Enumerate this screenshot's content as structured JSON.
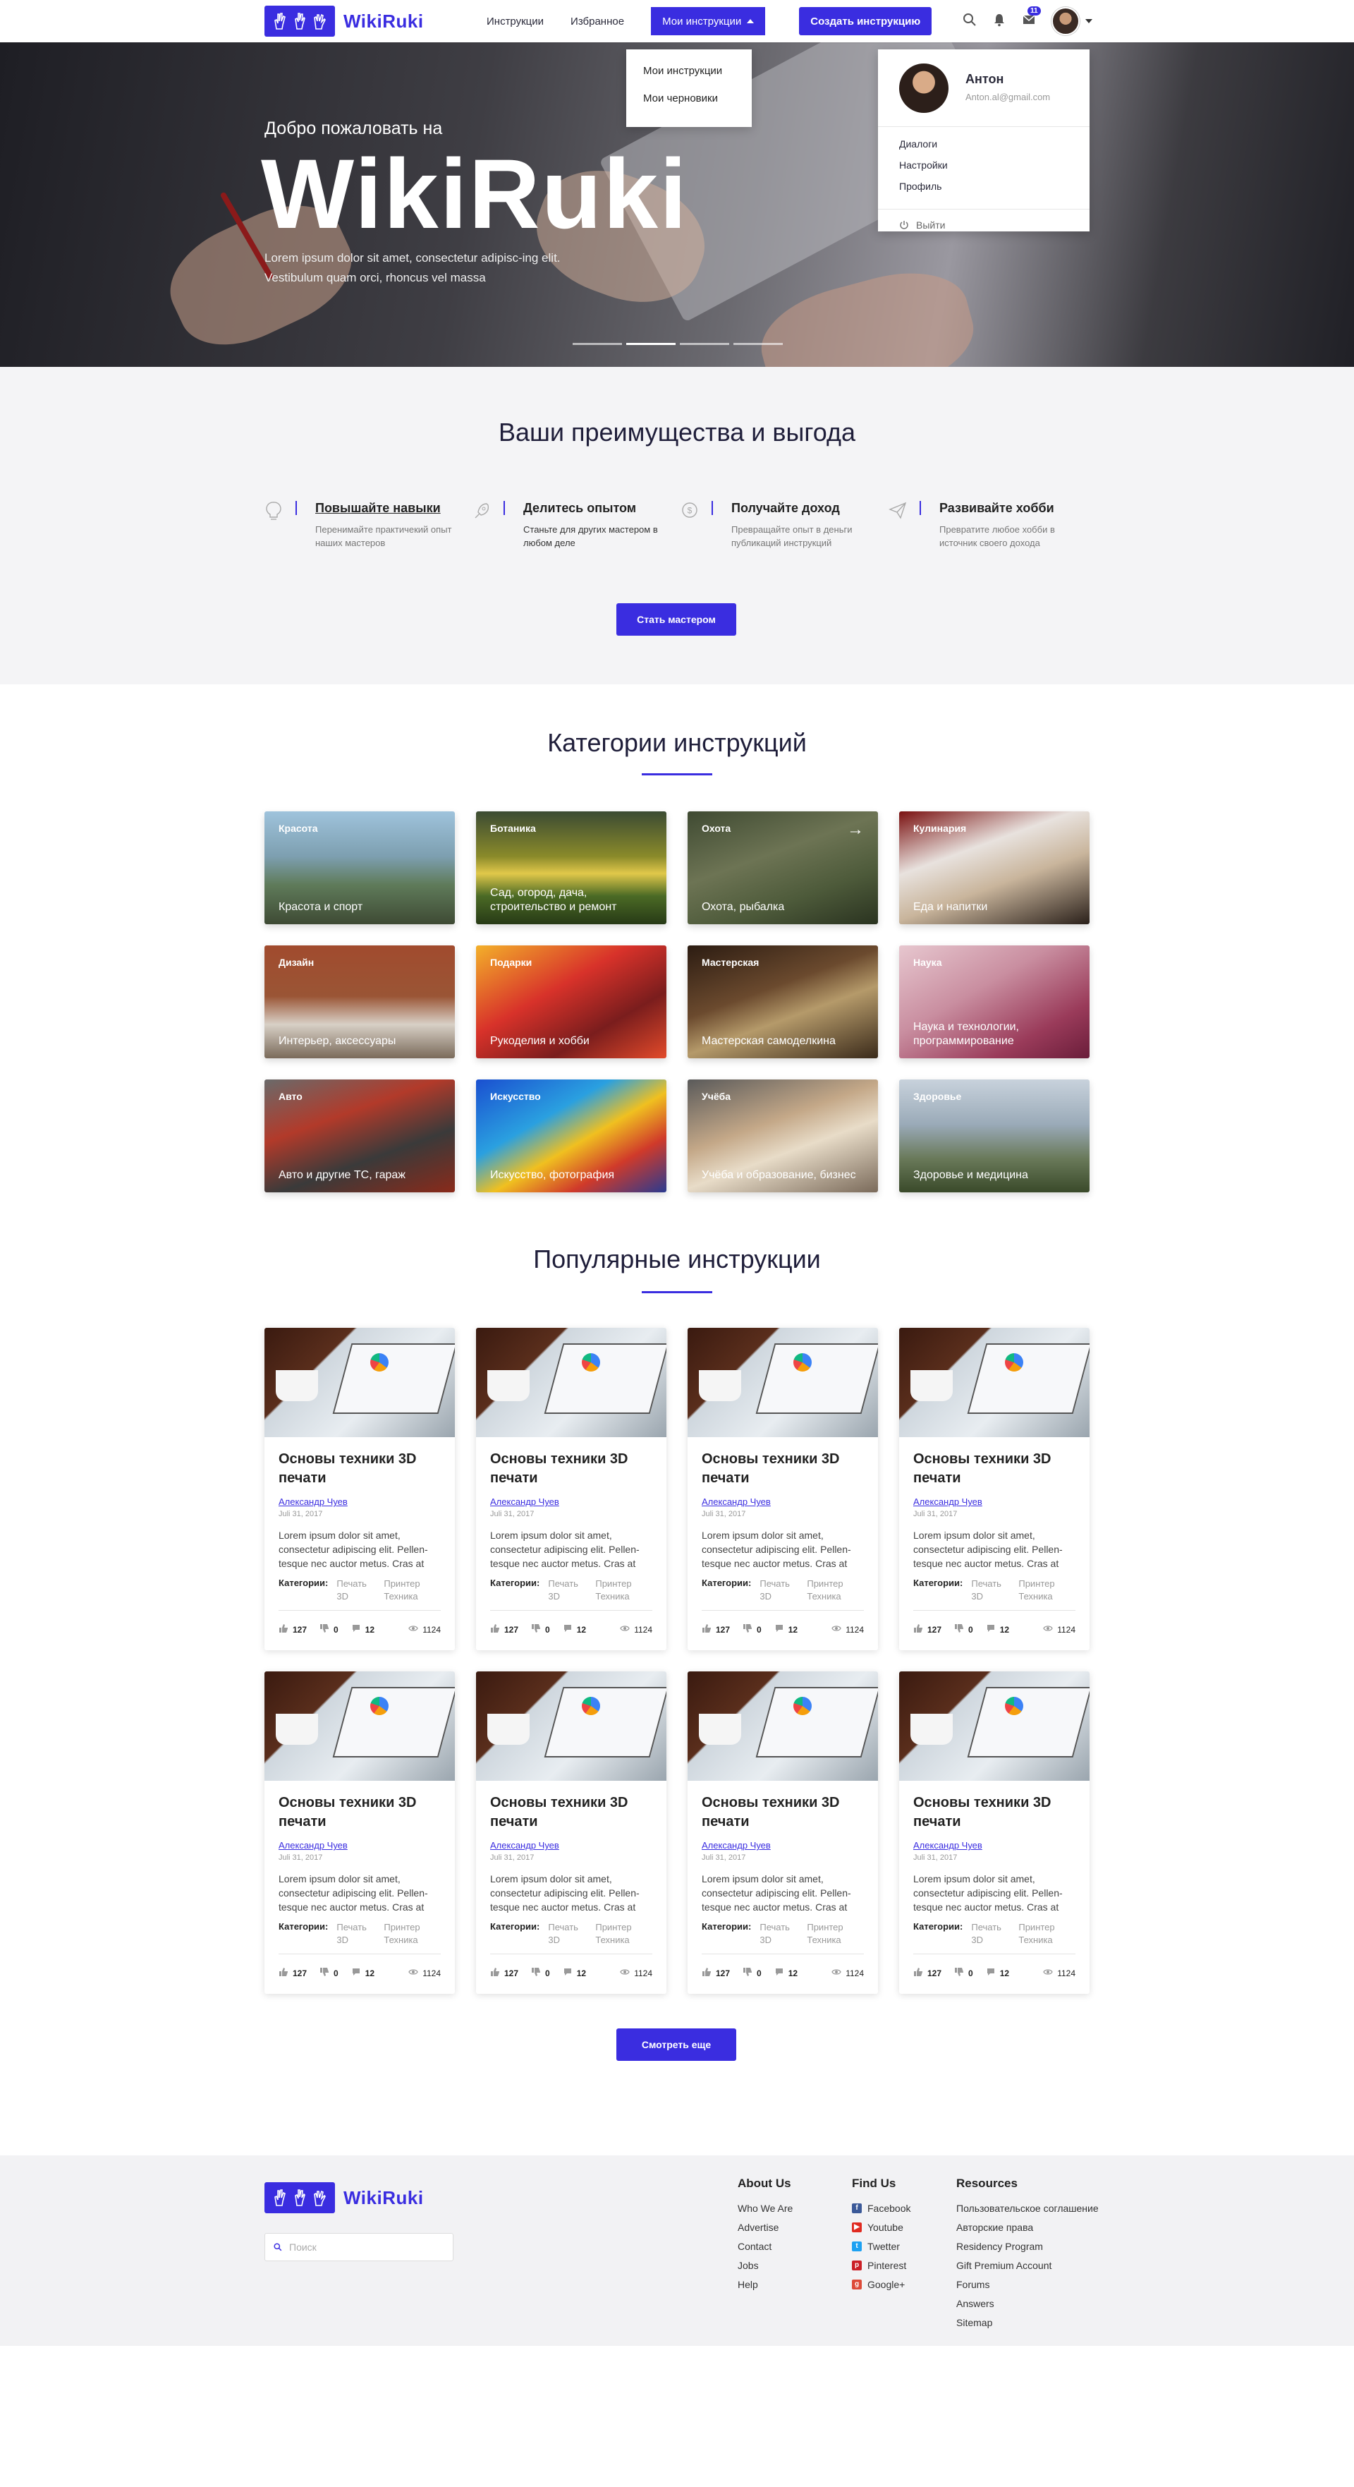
{
  "brand": {
    "name": "WikiRuki"
  },
  "nav": {
    "items": [
      "Инструкции",
      "Избранное"
    ],
    "active": "Мои инструкции",
    "cta": "Создать инструкцию",
    "mail_badge": "11"
  },
  "dropdown_instructions": [
    "Мои инструкции",
    "Мои черновики"
  ],
  "user_menu": {
    "name": "Антон",
    "email": "Anton.al@gmail.com",
    "items": [
      "Диалоги",
      "Настройки",
      "Профиль"
    ],
    "logout": "Выйти"
  },
  "hero": {
    "welcome": "Добро пожаловать на",
    "title": "WikiRuki",
    "text": "Lorem ipsum dolor sit amet, consectetur adipisc-ing elit. Vestibulum quam orci, rhoncus vel massa"
  },
  "benefits": {
    "title": "Ваши преимущества и выгода",
    "items": [
      {
        "icon": "lightbulb-icon",
        "title": "Повышайте навыки",
        "text": "Перенимайте практичекий опыт наших мастеров"
      },
      {
        "icon": "rocket-icon",
        "title": "Делитесь опытом",
        "text": "Станьте для других мастером в любом деле"
      },
      {
        "icon": "dollar-icon",
        "title": "Получайте доход",
        "text": "Превращайте опыт в деньги публикаций инструкций"
      },
      {
        "icon": "paper-plane-icon",
        "title": "Развивайте хобби",
        "text": "Превратите любое хобби в источник своего дохода"
      }
    ],
    "button": "Стать мастером"
  },
  "categories": {
    "title": "Категории инструкций",
    "items": [
      {
        "name": "Красота",
        "desc": "Красота и спорт",
        "bg": "linear-gradient(180deg,#9fc3dc 0%,#7d9fb0 40%,#5f7b5a 65%,#3e4a34 100%)"
      },
      {
        "name": "Ботаника",
        "desc": "Сад, огород, дача, строительство и ремонт",
        "bg": "linear-gradient(180deg,#3b4b33 0%,#8a8a2a 40%,#e1c84a 55%,#4b6a25 75%,#273a16 100%)"
      },
      {
        "name": "Охота",
        "desc": "Охота, рыбалка",
        "bg": "linear-gradient(160deg,#3f4a32 0%,#6d7454 40%,#4d5a3a 70%,#2a3320 100%)"
      },
      {
        "name": "Кулинария",
        "desc": "Еда и напитки",
        "bg": "linear-gradient(160deg,#7a1010 0%,#e8e2de 35%,#c9b59c 60%,#2a201a 100%)"
      },
      {
        "name": "Дизайн",
        "desc": "Интерьер, аксессуары",
        "bg": "linear-gradient(180deg,#a14b2e 0%,#9a5535 45%,#d8d0c6 70%,#7a6a5a 100%)"
      },
      {
        "name": "Подарки",
        "desc": "Рукоделия и хобби",
        "bg": "linear-gradient(150deg,#f3b02a 0%,#d8322a 40%,#7a1d1d 70%,#e24a2a 100%)"
      },
      {
        "name": "Мастерская",
        "desc": "Мастерская самоделкина",
        "bg": "linear-gradient(160deg,#2c1c12 0%,#6b4a2e 40%,#b59a6a 60%,#3a2a1a 100%)"
      },
      {
        "name": "Наука",
        "desc": "Наука и технологии, программирование",
        "bg": "linear-gradient(150deg,#e7c7cf 0%,#c98ea0 40%,#9a3b5a 75%,#6a1d3a 100%)"
      },
      {
        "name": "Авто",
        "desc": "Авто и другие ТС, гараж",
        "bg": "linear-gradient(160deg,#6a6a6a 0%,#b23a2a 35%,#3a3a3a 65%,#8a2a1a 100%)"
      },
      {
        "name": "Искусство",
        "desc": "Искусство, фотография",
        "bg": "linear-gradient(150deg,#1a4fd0 0%,#2aa0e0 35%,#f0c020 55%,#d03a2a 75%,#2a3a90 100%)"
      },
      {
        "name": "Учёба",
        "desc": "Учёба и образование, бизнес",
        "bg": "linear-gradient(160deg,#5a5a5a 0%,#c4a888 40%,#e8dcc8 60%,#7a6a5a 100%)"
      },
      {
        "name": "Здоровье",
        "desc": "Здоровье и медицина",
        "bg": "linear-gradient(180deg,#c8d2dc 0%,#9aaab8 40%,#6a7a5a 70%,#3a4a2a 100%)"
      }
    ]
  },
  "popular": {
    "title": "Популярные инструкции",
    "cards": [
      {
        "title": "Основы техники 3D печати",
        "author": "Александр Чуев",
        "date": "Juli 31, 2017",
        "text": "Lorem ipsum dolor sit amet, consectetur adipiscing elit. Pellen-tesque nec auctor metus. Cras at",
        "cats_label": "Категории:",
        "cat1": "Печать 3D",
        "cat2": "Принтер Техника",
        "likes": "127",
        "dislikes": "0",
        "comments": "12",
        "views": "1124"
      },
      {
        "title": "Основы техники 3D печати",
        "author": "Александр Чуев",
        "date": "Juli 31, 2017",
        "text": "Lorem ipsum dolor sit amet, consectetur adipiscing elit. Pellen-tesque nec auctor metus. Cras at",
        "cats_label": "Категории:",
        "cat1": "Печать 3D",
        "cat2": "Принтер Техника",
        "likes": "127",
        "dislikes": "0",
        "comments": "12",
        "views": "1124"
      },
      {
        "title": "Основы техники 3D печати",
        "author": "Александр Чуев",
        "date": "Juli 31, 2017",
        "text": "Lorem ipsum dolor sit amet, consectetur adipiscing elit. Pellen-tesque nec auctor metus. Cras at",
        "cats_label": "Категории:",
        "cat1": "Печать 3D",
        "cat2": "Принтер Техника",
        "likes": "127",
        "dislikes": "0",
        "comments": "12",
        "views": "1124"
      },
      {
        "title": "Основы техники 3D печати",
        "author": "Александр Чуев",
        "date": "Juli 31, 2017",
        "text": "Lorem ipsum dolor sit amet, consectetur adipiscing elit. Pellen-tesque nec auctor metus. Cras at",
        "cats_label": "Категории:",
        "cat1": "Печать 3D",
        "cat2": "Принтер Техника",
        "likes": "127",
        "dislikes": "0",
        "comments": "12",
        "views": "1124"
      },
      {
        "title": "Основы техники 3D печати",
        "author": "Александр Чуев",
        "date": "Juli 31, 2017",
        "text": "Lorem ipsum dolor sit amet, consectetur adipiscing elit. Pellen-tesque nec auctor metus. Cras at",
        "cats_label": "Категории:",
        "cat1": "Печать 3D",
        "cat2": "Принтер Техника",
        "likes": "127",
        "dislikes": "0",
        "comments": "12",
        "views": "1124"
      },
      {
        "title": "Основы техники 3D печати",
        "author": "Александр Чуев",
        "date": "Juli 31, 2017",
        "text": "Lorem ipsum dolor sit amet, consectetur adipiscing elit. Pellen-tesque nec auctor metus. Cras at",
        "cats_label": "Категории:",
        "cat1": "Печать 3D",
        "cat2": "Принтер Техника",
        "likes": "127",
        "dislikes": "0",
        "comments": "12",
        "views": "1124"
      },
      {
        "title": "Основы техники 3D печати",
        "author": "Александр Чуев",
        "date": "Juli 31, 2017",
        "text": "Lorem ipsum dolor sit amet, consectetur adipiscing elit. Pellen-tesque nec auctor metus. Cras at",
        "cats_label": "Категории:",
        "cat1": "Печать 3D",
        "cat2": "Принтер Техника",
        "likes": "127",
        "dislikes": "0",
        "comments": "12",
        "views": "1124"
      },
      {
        "title": "Основы техники 3D печати",
        "author": "Александр Чуев",
        "date": "Juli 31, 2017",
        "text": "Lorem ipsum dolor sit amet, consectetur adipiscing elit. Pellen-tesque nec auctor metus. Cras at",
        "cats_label": "Категории:",
        "cat1": "Печать 3D",
        "cat2": "Принтер Техника",
        "likes": "127",
        "dislikes": "0",
        "comments": "12",
        "views": "1124"
      }
    ],
    "more_button": "Смотреть еще"
  },
  "footer": {
    "search_placeholder": "Поиск",
    "about": {
      "title": "About Us",
      "items": [
        "Who We Are",
        "Advertise",
        "Contact",
        "Jobs",
        "Help"
      ]
    },
    "find": {
      "title": "Find Us",
      "items": [
        {
          "label": "Facebook",
          "icon": "facebook-icon",
          "color": "#3b5998"
        },
        {
          "label": "Youtube",
          "icon": "youtube-icon",
          "color": "#e02a20"
        },
        {
          "label": "Twetter",
          "icon": "twitter-icon",
          "color": "#1da1f2"
        },
        {
          "label": "Pinterest",
          "icon": "pinterest-icon",
          "color": "#cb2027"
        },
        {
          "label": "Google+",
          "icon": "google-plus-icon",
          "color": "#dd4b39"
        }
      ]
    },
    "resources": {
      "title": "Resources",
      "items": [
        "Пользовательское соглашение",
        "Авторские права",
        "Residency Program",
        "Gift Premium Account",
        "Forums",
        "Answers",
        "Sitemap"
      ]
    }
  },
  "colors": {
    "accent": "#3a2de0"
  }
}
